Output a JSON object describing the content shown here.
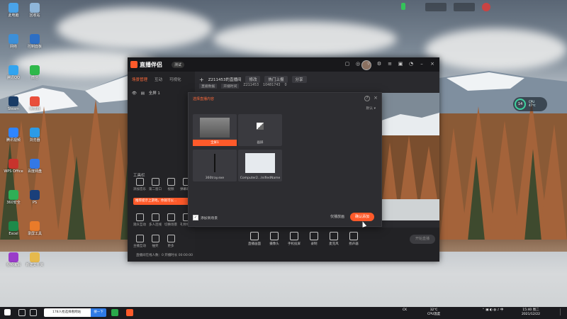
{
  "desktop": {
    "icons_left": [
      {
        "label": "此电脑",
        "color": "#4aa3e8"
      },
      {
        "label": "回收站",
        "color": "#8fb6d9"
      },
      {
        "label": "网络",
        "color": "#3c8fd8"
      },
      {
        "label": "控制面板",
        "color": "#2e6fc4"
      },
      {
        "label": "腾讯QQ",
        "color": "#31a4f0"
      },
      {
        "label": "微信",
        "color": "#2fb84a"
      },
      {
        "label": "Steam",
        "color": "#1a3c66"
      },
      {
        "label": "播放器",
        "color": "#e94f3b"
      },
      {
        "label": "腾讯视频",
        "color": "#2f85ff"
      },
      {
        "label": "浏览器",
        "color": "#2c9be6"
      },
      {
        "label": "WPS Office",
        "color": "#c8332c"
      },
      {
        "label": "百度网盘",
        "color": "#3378e6"
      },
      {
        "label": "360安全",
        "color": "#2faf56"
      },
      {
        "label": "PS",
        "color": "#1a3f7a"
      },
      {
        "label": "Excel",
        "color": "#1d8a4a"
      },
      {
        "label": "录屏工具",
        "color": "#e97b2a"
      },
      {
        "label": "视频编辑",
        "color": "#9a3cc9"
      },
      {
        "label": "新建文件夹",
        "color": "#e6b94c"
      }
    ]
  },
  "app": {
    "logo": "直播伴侣",
    "badge": "测试",
    "left_tabs": [
      "场景管理",
      "互动",
      "可视化"
    ],
    "scene_item": "全屏 1",
    "tools_title": "工具栏",
    "tip": "推荐提示上游戏，你就可以...",
    "tools": [
      "添加音乐",
      "第二窗口",
      "视频",
      "弹幕助手",
      "观众互动",
      "多人连线",
      "切换场景",
      "礼物特效",
      "主播互动",
      "抽奖",
      "更多"
    ],
    "room_name": "Z211453的直播间",
    "edit_label": "修改",
    "room_btn1": "热门上报",
    "room_btn2": "分享",
    "id_row": [
      "直播数据",
      "开播时间",
      "Z211453",
      "10481743",
      "0"
    ],
    "bottom_tools": [
      "直播画面",
      "摄像头",
      "手机投屏",
      "录制",
      "麦克风",
      "扬声器"
    ],
    "go_live": "开始直播",
    "status_text": "直播间在线人数：0  开播时长 00:00:00"
  },
  "dialog": {
    "title": "选择直播内容",
    "sort": "默认",
    "sources": [
      {
        "label": "全屏1",
        "selected": true
      },
      {
        "label": "画屏",
        "selected": false
      },
      {
        "label": "360tray.exe",
        "selected": false
      },
      {
        "label": "Computer2...lnifiedName",
        "selected": false
      }
    ],
    "checkbox_label": "添加到场景",
    "cancel_label": "仅播放画",
    "ok_label": "确认添加"
  },
  "cpu_widget": {
    "value": "14",
    "unit": "%",
    "label1": "CPU",
    "label2": "47℃"
  },
  "taskbar": {
    "search_text": "178人抢选择看网站",
    "search_btn": "搜一下",
    "temp": "32℃",
    "cpu_temp": "CPU温度",
    "time": "15:40 周二",
    "date": "2021/12/22",
    "lang": "CK"
  }
}
